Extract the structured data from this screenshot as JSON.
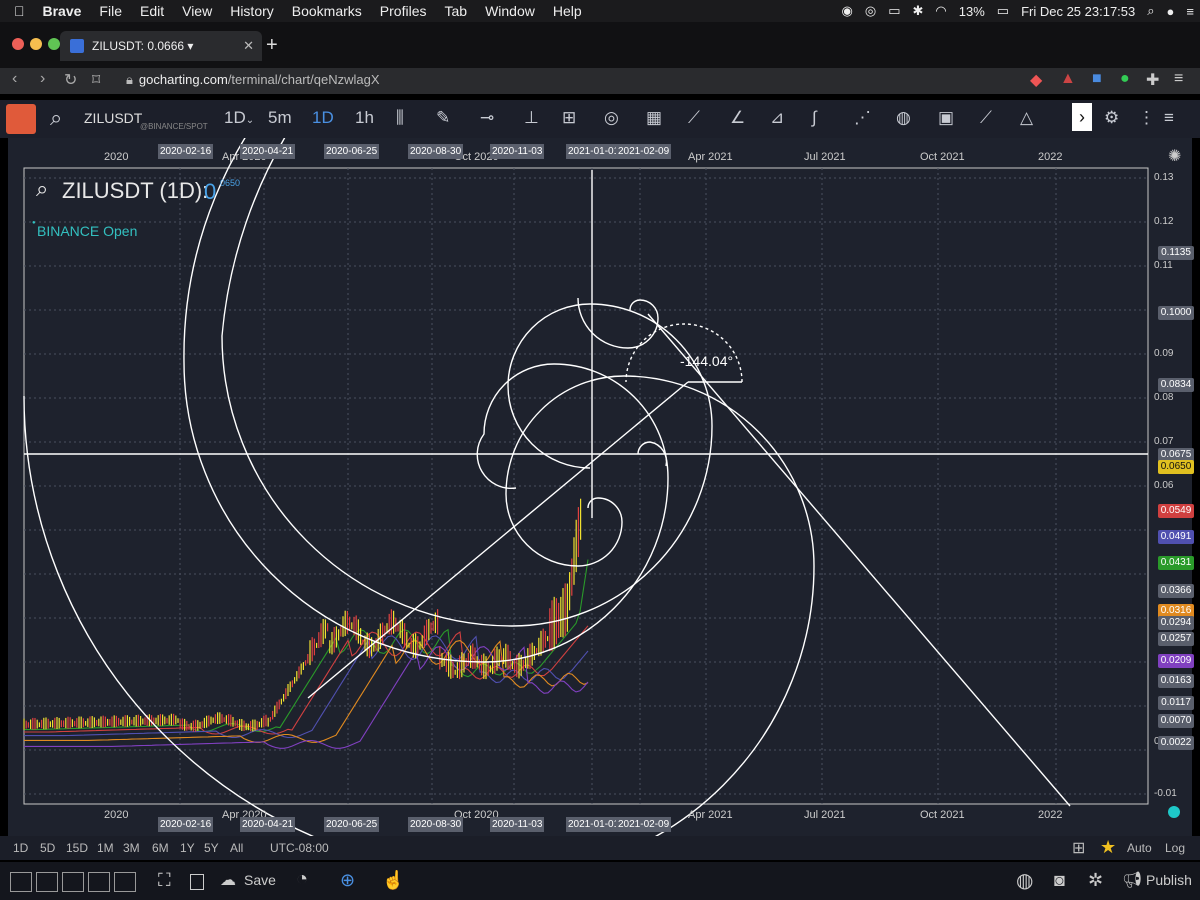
{
  "menubar": {
    "app": "Brave",
    "items": [
      "File",
      "Edit",
      "View",
      "History",
      "Bookmarks",
      "Profiles",
      "Tab",
      "Window",
      "Help"
    ],
    "battery": "13%",
    "clock": "Fri Dec 25  23:17:53"
  },
  "browser": {
    "tab_title": "ZILUSDT: 0.0666 ▾",
    "url_domain": "gocharting.com",
    "url_path": "/terminal/chart/qeNzwlagX"
  },
  "toolbar": {
    "symbol": "ZILUSDT",
    "exchange": "@BINANCE/SPOT",
    "interval_dropdown": "1D",
    "intervals": [
      "5m",
      "1D",
      "1h"
    ],
    "active_interval": "1D"
  },
  "chart": {
    "title": "ZILUSDT (1D):",
    "title_value": "0",
    "superscript": "0650",
    "exchange_status": "BINANCE Open",
    "angle_label": "-144.04°",
    "top_axis_labels": [
      "2020",
      "Apr 2020",
      "Oct 2020",
      "Apr 2021",
      "Jul 2021",
      "Oct 2021",
      "2022"
    ],
    "bottom_axis_labels": [
      "2020",
      "Apr 2020",
      "Oct 2020",
      "Apr 2021",
      "Jul 2021",
      "Oct 2021",
      "2022"
    ],
    "date_markers": [
      "2020-02-16",
      "2020-04-21",
      "2020-06-25",
      "2020-08-30",
      "2020-11-03",
      "2021-01-01",
      "2021-02-09"
    ],
    "price_ticks": [
      "0.13",
      "0.12",
      "0.11",
      "0.09",
      "0.08",
      "0.07",
      "0.06",
      "0.00",
      "-0.01"
    ],
    "price_badges": [
      {
        "label": "0.1135",
        "color": "#5a5f6c"
      },
      {
        "label": "0.1000",
        "color": "#5a5f6c"
      },
      {
        "label": "0.0834",
        "color": "#5a5f6c"
      },
      {
        "label": "0.0675",
        "color": "#5a5f6c"
      },
      {
        "label": "0.0650",
        "color": "#e0c020"
      },
      {
        "label": "0.0549",
        "color": "#d04040"
      },
      {
        "label": "0.0491",
        "color": "#5050b0"
      },
      {
        "label": "0.0431",
        "color": "#2a9a2a"
      },
      {
        "label": "0.0366",
        "color": "#5a5f6c"
      },
      {
        "label": "0.0316",
        "color": "#e08a20"
      },
      {
        "label": "0.0294",
        "color": "#5a5f6c"
      },
      {
        "label": "0.0257",
        "color": "#5a5f6c"
      },
      {
        "label": "0.0209",
        "color": "#8040c0"
      },
      {
        "label": "0.0163",
        "color": "#5a5f6c"
      },
      {
        "label": "0.0117",
        "color": "#5a5f6c"
      },
      {
        "label": "0.0070",
        "color": "#5a5f6c"
      },
      {
        "label": "0.0022",
        "color": "#5a5f6c"
      }
    ]
  },
  "rangebar": {
    "ranges": [
      "1D",
      "5D",
      "15D",
      "1M",
      "3M",
      "6M",
      "1Y",
      "5Y",
      "All"
    ],
    "timezone": "UTC-08:00",
    "auto": "Auto",
    "log": "Log"
  },
  "bottom_toolbar": {
    "save": "Save",
    "publish": "Publish"
  }
}
